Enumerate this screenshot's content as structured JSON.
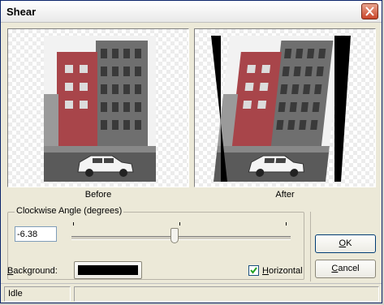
{
  "window": {
    "title": "Shear"
  },
  "previews": {
    "before_label": "Before",
    "after_label": "After"
  },
  "angle": {
    "group_label": "Clockwise Angle (degrees)",
    "value": "-6.38",
    "slider_level": 0.47
  },
  "background": {
    "label": "Background:",
    "color": "#000000"
  },
  "horizontal": {
    "label": "Horizontal",
    "checked": true
  },
  "buttons": {
    "ok": "OK",
    "cancel": "Cancel"
  },
  "status": {
    "text": "Idle"
  },
  "colors": {
    "title_close": "#c9452a",
    "building_red": "#a8454a",
    "sky": "#f2f2f2"
  }
}
